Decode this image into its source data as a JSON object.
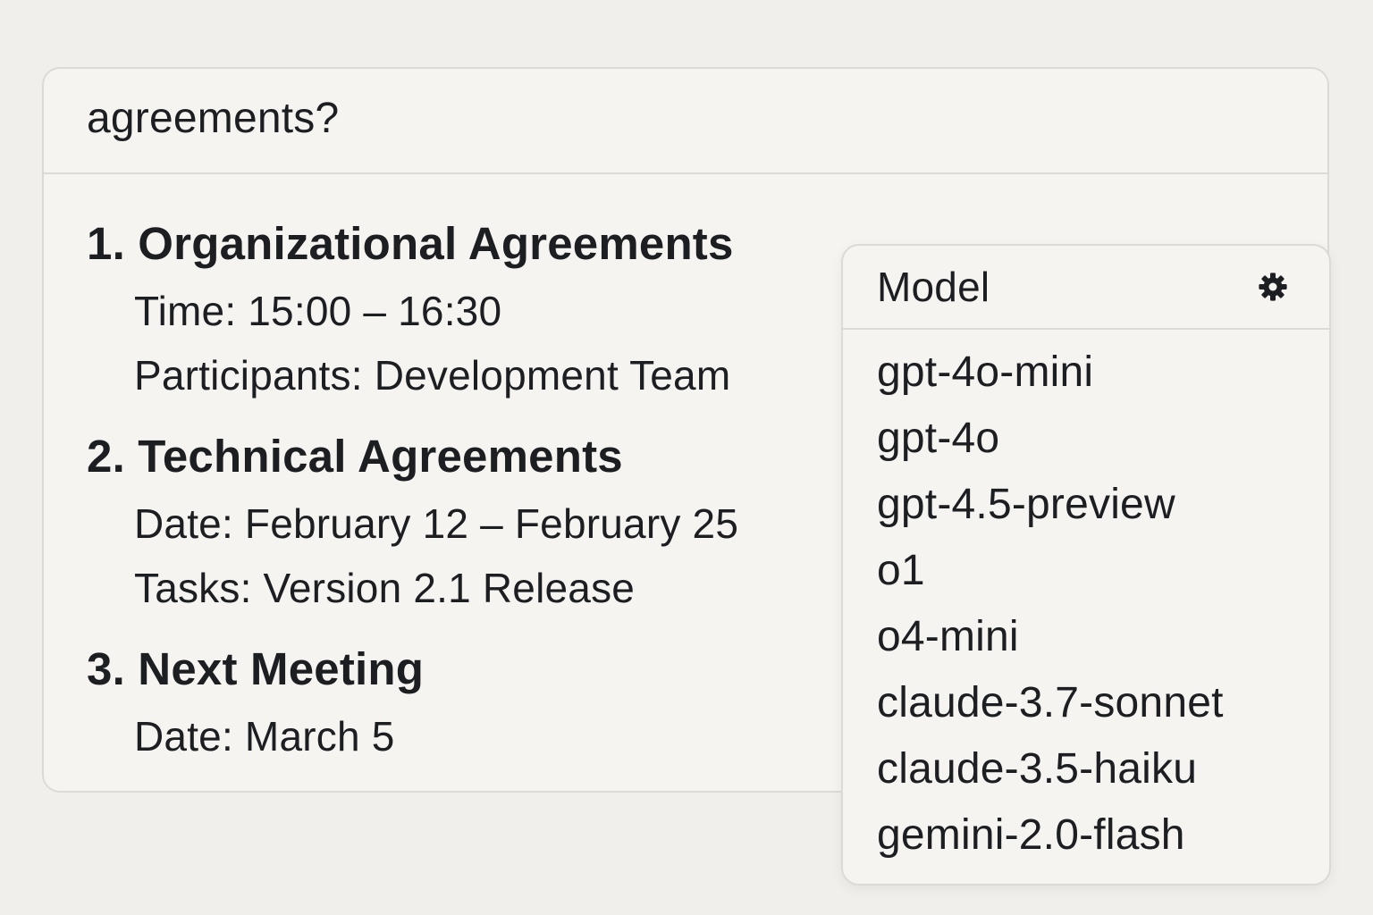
{
  "query": {
    "text": "agreements?"
  },
  "answer": {
    "sections": [
      {
        "title": "1. Organizational Agreements",
        "lines": [
          "Time: 15:00 – 16:30",
          "Participants: Development Team"
        ]
      },
      {
        "title": "2. Technical Agreements",
        "lines": [
          "Date: February 12 – February 25",
          "Tasks: Version 2.1 Release"
        ]
      },
      {
        "title": "3. Next Meeting",
        "lines": [
          "Date: March 5"
        ]
      }
    ]
  },
  "model_dropdown": {
    "title": "Model",
    "settings_icon": "gear-icon",
    "options": [
      "gpt-4o-mini",
      "gpt-4o",
      "gpt-4.5-preview",
      "o1",
      "o4-mini",
      "claude-3.7-sonnet",
      "claude-3.5-haiku",
      "gemini-2.0-flash"
    ]
  },
  "colors": {
    "background": "#f1efec",
    "panel": "#f6f4f1",
    "border": "#dddad6",
    "text": "#1c1e22"
  }
}
